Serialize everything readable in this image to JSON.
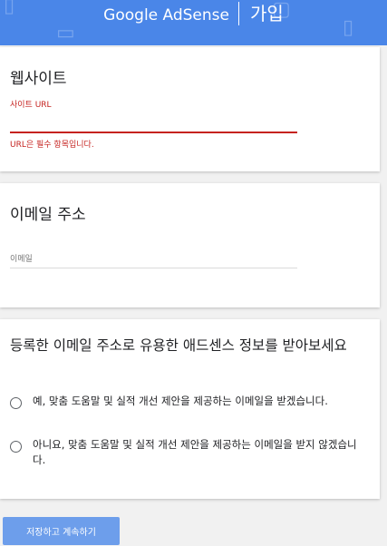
{
  "header": {
    "brand": "Google AdSense",
    "page_label": "가입"
  },
  "website": {
    "title": "웹사이트",
    "field_label": "사이트 URL",
    "value": "",
    "error": "URL은 필수 항목입니다."
  },
  "email": {
    "title": "이메일 주소",
    "field_label": "이메일",
    "value": ""
  },
  "newsletter": {
    "question": "등록한 이메일 주소로 유용한 애드센스 정보를 받아보세요",
    "options": [
      {
        "label": "예, 맞춤 도움말 및 실적 개선 제안을 제공하는 이메일을 받겠습니다.",
        "selected": false
      },
      {
        "label": "아니요, 맞춤 도움말 및 실적 개선 제안을 제공하는 이메일을 받지 않겠습니다.",
        "selected": false
      }
    ]
  },
  "submit_label": "저장하고 계속하기",
  "colors": {
    "header_bg": "#4a86e8",
    "error": "#c5221f",
    "button_bg": "#6d9eeb"
  }
}
